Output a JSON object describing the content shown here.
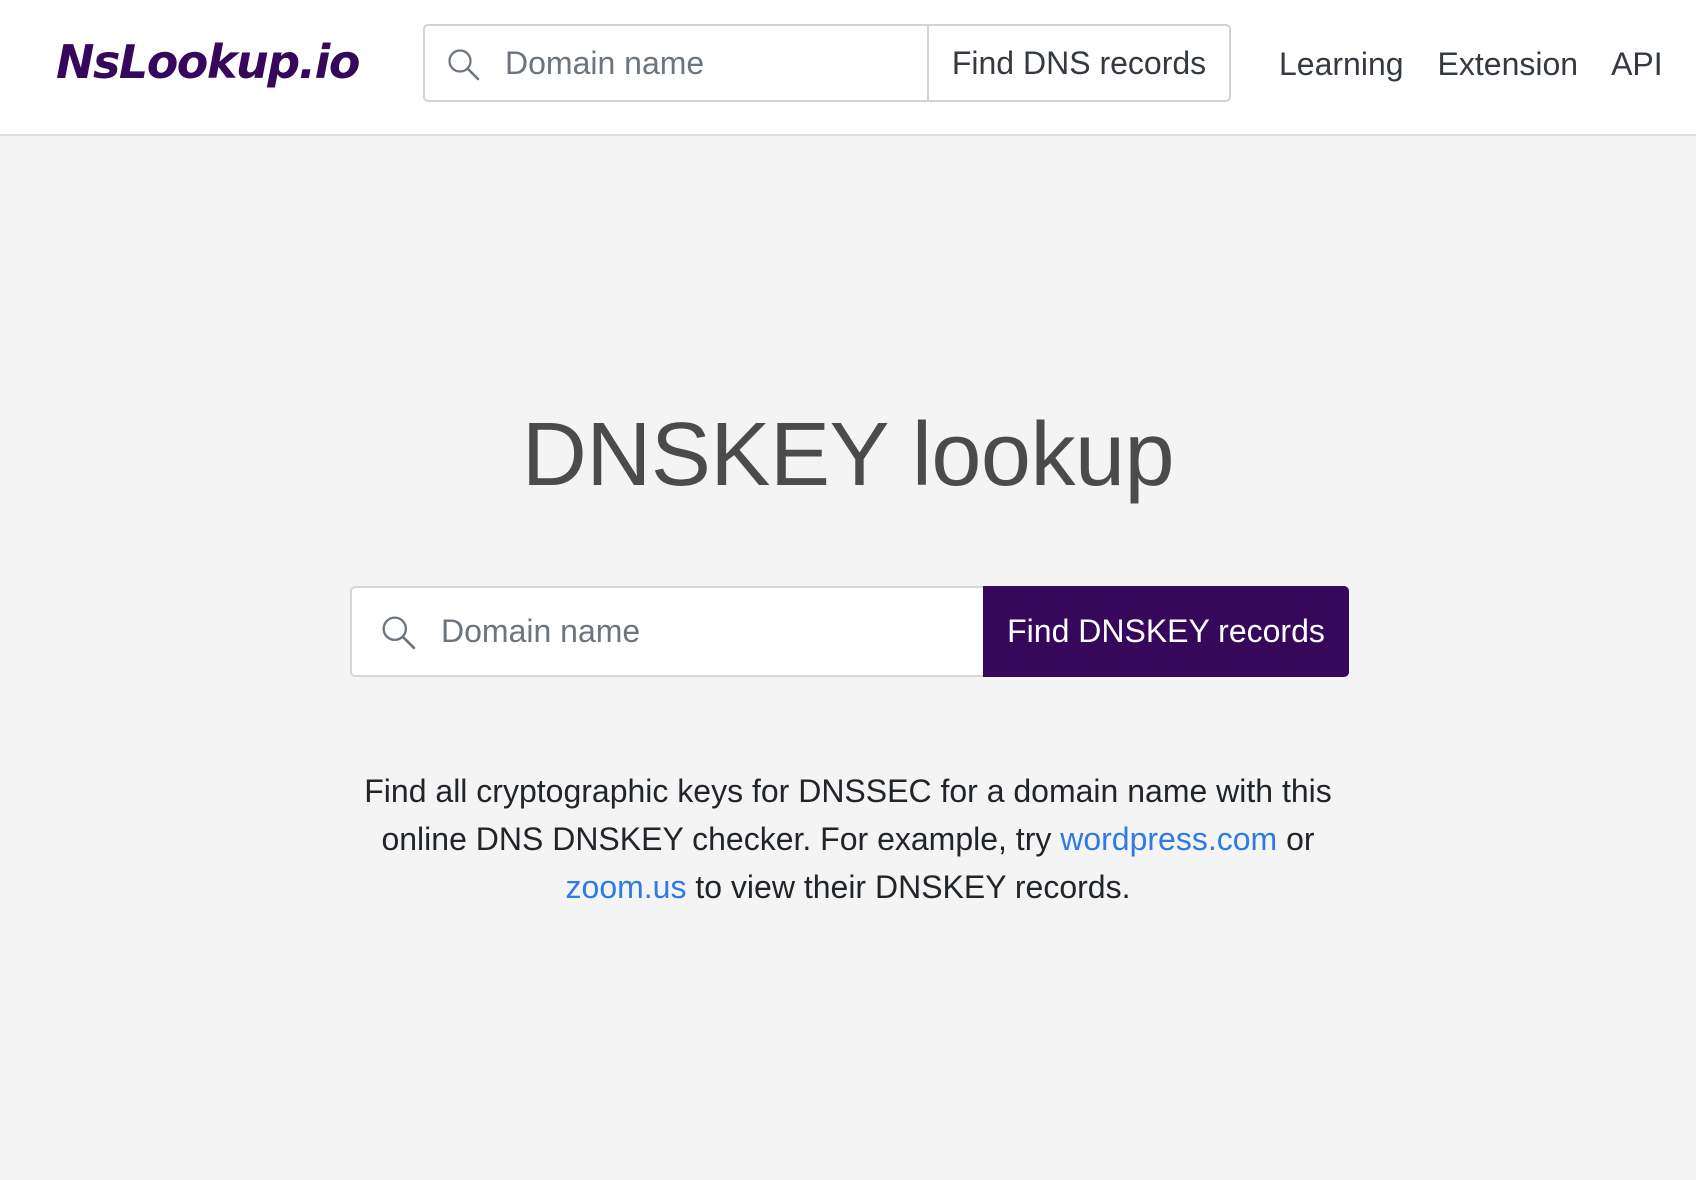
{
  "header": {
    "logo": "NsLookup.io",
    "search": {
      "placeholder": "Domain name",
      "value": "",
      "icon": "search-icon",
      "button_label": "Find DNS records"
    },
    "nav": [
      {
        "label": "Learning"
      },
      {
        "label": "Extension"
      },
      {
        "label": "API"
      }
    ]
  },
  "main": {
    "title": "DNSKEY lookup",
    "search": {
      "placeholder": "Domain name",
      "value": "",
      "icon": "search-icon",
      "button_label": "Find DNSKEY records"
    },
    "description": {
      "part1": "Find all cryptographic keys for DNSSEC for a domain name with this online DNS DNSKEY checker. For example, try ",
      "link1": "wordpress.com",
      "part2": " or ",
      "link2": "zoom.us",
      "part3": " to view their DNSKEY records."
    }
  },
  "colors": {
    "brand": "#36075b",
    "link": "#2f7ae5",
    "background": "#f4f4f4",
    "title_text": "#4b4b4b"
  }
}
